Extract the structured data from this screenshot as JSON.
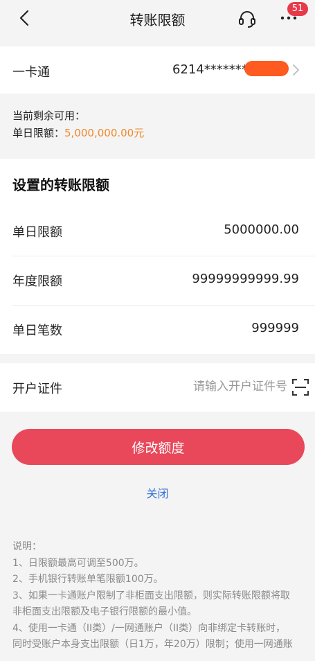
{
  "header": {
    "title": "转账限额",
    "badge_count": "51",
    "icons": {
      "back": "chevron-left-icon",
      "service": "headset-icon",
      "more": "more-dots-icon"
    }
  },
  "card": {
    "label": "一卡通",
    "number_masked": "6214*******"
  },
  "available": {
    "title": "当前剩余可用：",
    "daily_label": "单日限额：",
    "daily_value": "5,000,000.00元",
    "value_color": "#f0892a"
  },
  "limits": {
    "section_title": "设置的转账限额",
    "rows": [
      {
        "label": "单日限额",
        "value": "5000000.00"
      },
      {
        "label": "年度限额",
        "value": "99999999999.99"
      },
      {
        "label": "单日笔数",
        "value": "999999"
      }
    ]
  },
  "id_field": {
    "label": "开户证件",
    "placeholder": "请输入开户证件号",
    "value": ""
  },
  "actions": {
    "modify_label": "修改额度",
    "close_label": "关闭",
    "accent": "#e8485a",
    "link_color": "#2f6fd6"
  },
  "notes": {
    "lines": [
      "说明：",
      "1、日限额最高可调至500万。",
      "2、手机银行转账单笔限额100万。",
      "3、如果一卡通账户限制了非柜面支出限额，则实际转账限额将取",
      "非柜面支出限额及电子银行限额的最小值。",
      "4、使用一卡通（II类）/一网通账户（II类）向非绑定卡转账时，",
      "同时受账户本身支出限额（日1万，年20万）限制；使用一网通账"
    ]
  }
}
